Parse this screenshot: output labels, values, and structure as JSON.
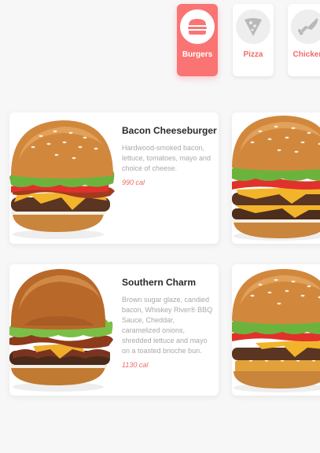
{
  "categories": [
    {
      "label": "Burgers",
      "icon": "burger-icon",
      "active": true
    },
    {
      "label": "Pizza",
      "icon": "pizza-icon",
      "active": false
    },
    {
      "label": "Chicken",
      "icon": "chicken-icon",
      "active": false
    }
  ],
  "menu": [
    {
      "title": "Bacon Cheeseburger",
      "description": "Hardwood-smoked bacon, lettuce, tomatoes, mayo and choice of cheese.",
      "calories": "990 cal"
    },
    {
      "title": "Southern Charm",
      "description": "Brown sugar glaze, candied bacon, Whiskey River® BBQ Sauce, Cheddar, caramelized onions, shredded lettuce and mayo on a toasted brioche bun.",
      "calories": "1130 cal"
    }
  ],
  "colors": {
    "accent": "#fb7474",
    "accent_text": "#f26a6a",
    "title_text": "#2a2a2a",
    "muted_text": "#a9a9a9",
    "background": "#f7f7f7"
  }
}
